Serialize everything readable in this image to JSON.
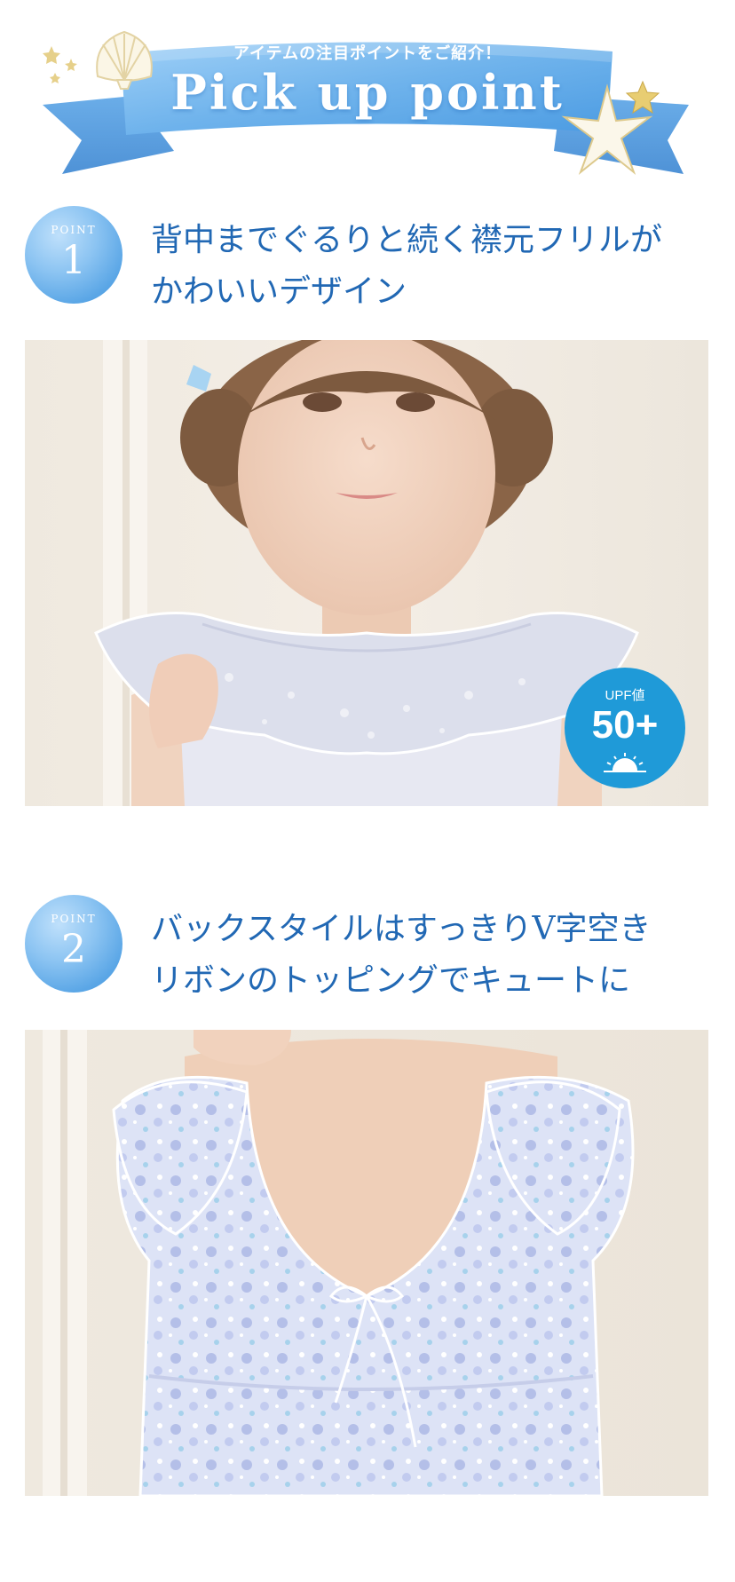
{
  "banner": {
    "subtitle": "アイテムの注目ポイントをご紹介！",
    "title": "Pick up point"
  },
  "points": [
    {
      "badge_label": "POINT",
      "number": "1",
      "title_lines": [
        "背中までぐるりと続く襟元フリルが",
        "かわいいデザイン"
      ]
    },
    {
      "badge_label": "POINT",
      "number": "2",
      "title_lines": [
        "バックスタイルはすっきりV字空き",
        "リボンのトッピングでキュートに"
      ]
    }
  ],
  "upf_badge": {
    "label": "UPF値",
    "value": "50+"
  },
  "colors": {
    "title_blue": "#2168b4",
    "badge_blue": "#1f9ad8",
    "ribbon_blue": "#6fb3ec"
  },
  "icons": [
    "shell-icon",
    "starfish-icon",
    "star-icon",
    "sun-icon"
  ]
}
